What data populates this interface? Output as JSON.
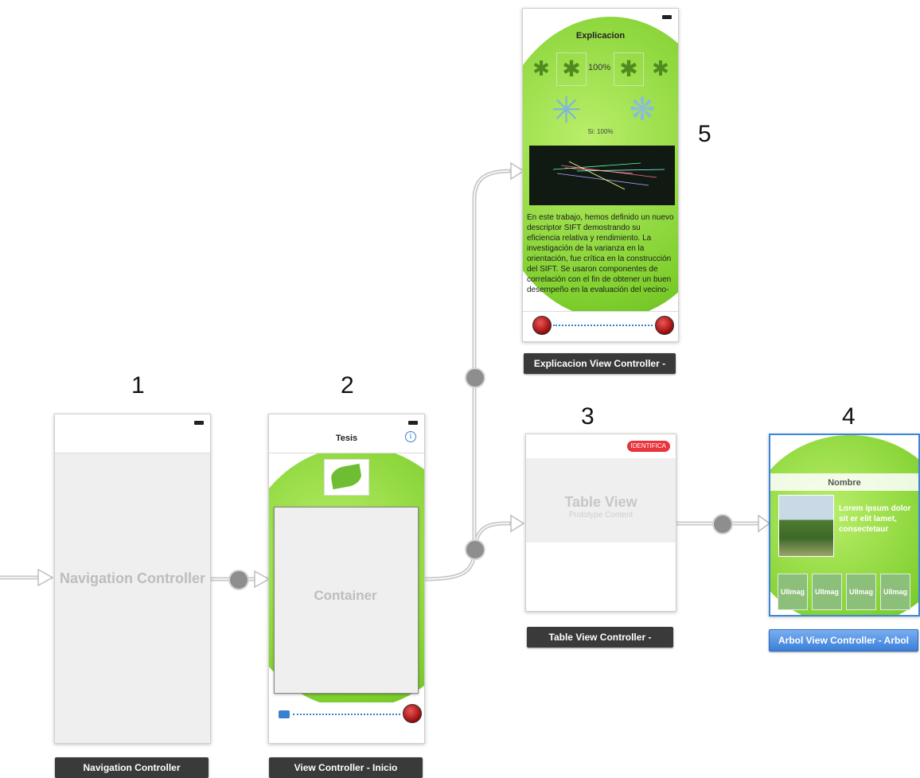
{
  "scene_numbers": [
    "1",
    "2",
    "3",
    "4",
    "5"
  ],
  "navigation_controller": {
    "center_label": "Navigation Controller",
    "caption": "Navigation Controller"
  },
  "view_controller_inicio": {
    "nav_title": "Tesis",
    "container_label": "Container",
    "caption": "View Controller - Inicio"
  },
  "table_view_controller": {
    "badge": "IDENTIFICA",
    "table_title": "Table View",
    "table_subtitle": "Prototype Content",
    "caption": "Table View Controller -"
  },
  "arbol_view_controller": {
    "nav_title": "Nombre",
    "description": "Lorem ipsum dolor sit er elit lamet, consectetaur",
    "tiles": [
      "UIImag",
      "UIImag",
      "UIImag",
      "UIImag"
    ],
    "caption": "Arbol View Controller - Arbol"
  },
  "explicacion_view_controller": {
    "nav_title": "Explicacion",
    "percent": "100%",
    "similarity": "Si: 100%",
    "body_text": "En este trabajo, hemos definido un nuevo descriptor SIFT demostrando su eficiencia relativa y rendimiento. La investigación de la varianza en la orientación, fue crítica en la construcción del SIFT. Se usaron componentes de correlación con el fin de obtener un buen desempeño en la evaluación del vecino-",
    "caption": "Explicacion View Controller -"
  },
  "colors": {
    "selection_blue": "#3b86d8",
    "leaf_green": "#7fcf2e",
    "caption_dark": "#3a3a3a",
    "badge_red": "#e8343a"
  }
}
